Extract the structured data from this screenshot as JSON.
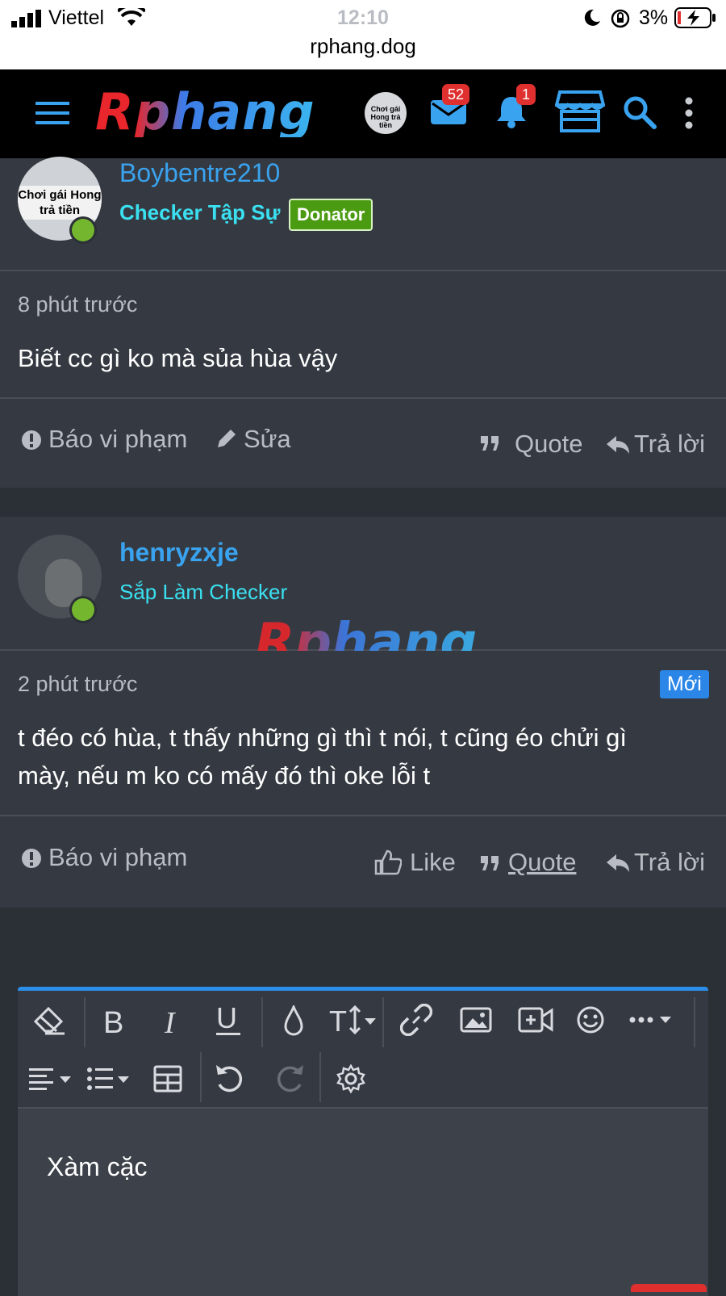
{
  "status_bar": {
    "carrier": "Viettel",
    "time": "12:10",
    "battery": "3%",
    "url": "rphang.dog"
  },
  "header": {
    "logo": "Rphang",
    "messages_count": "52",
    "alerts_count": "1",
    "avatar_text": "Chơi gái Hong trả tiền"
  },
  "posts": [
    {
      "username": "Boybentre210",
      "user_title": "Checker Tập Sự",
      "user_banner": "Donator",
      "avatar_text": "Chơi gái Hong trả tiền",
      "time": "8 phút trước",
      "message": "Biết cc gì ko mà sủa hùa vậy",
      "actions": {
        "report": "Báo vi phạm",
        "edit": "Sửa",
        "quote": "Quote",
        "reply": "Trả lời"
      }
    },
    {
      "username": "henryzxje",
      "user_title": "Sắp Làm Checker",
      "time": "2 phút trước",
      "new_label": "Mới",
      "message_line1": "t đéo có hùa, t thấy những gì thì t nói, t cũng éo chửi gì",
      "message_line2": "mày, nếu m ko có mấy đó thì oke lỗi t",
      "actions": {
        "report": "Báo vi phạm",
        "like": "Like",
        "quote": "Quote",
        "reply": "Trả lời"
      }
    }
  ],
  "watermark": "Rphang",
  "editor": {
    "text": "Xàm cặc"
  },
  "colors": {
    "accent": "#3aa3ef",
    "title_cyan": "#3ae0f0",
    "donator": "#4b9b12",
    "badge": "#e02f2f",
    "new_badge": "#2b86e8"
  }
}
